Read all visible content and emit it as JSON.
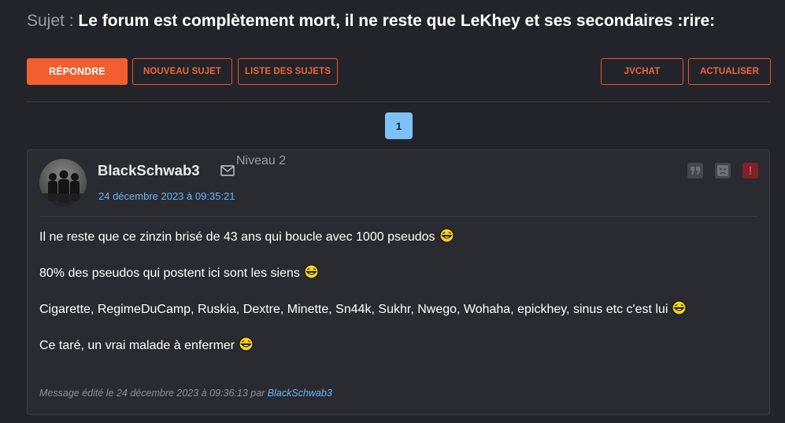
{
  "topic": {
    "label": "Sujet",
    "separator": ":",
    "title": "Le forum est complètement mort, il ne reste que LeKhey et ses secondaires :rire:"
  },
  "toolbar": {
    "reply": "RÉPONDRE",
    "new_topic": "NOUVEAU SUJET",
    "topic_list": "LISTE DES SUJETS",
    "jvchat": "JVCHAT",
    "refresh": "ACTUALISER"
  },
  "pagination": {
    "current_page": "1"
  },
  "post": {
    "author": "BlackSchwab3",
    "level": "Niveau 2",
    "date": "24 décembre 2023 à 09:35:21",
    "paragraphs": [
      "Il ne reste que ce zinzin brisé de 43 ans qui boucle avec 1000 pseudos",
      "80% des pseudos qui postent ici sont les siens",
      "Cigarette, RegimeDuCamp, Ruskia, Dextre, Minette, Sn44k, Sukhr, Nwego, Wohaha, epickhey, sinus etc c'est lui",
      "Ce taré, un vrai malade à enfermer"
    ],
    "paragraph_icons": [
      "laughing-smiley-icon",
      "laughing-smiley-icon",
      "laughing-smiley-icon",
      "laughing-smiley-icon"
    ],
    "edit_note_prefix": "Message édité le 24 décembre 2023 à 09:36:13 par",
    "edit_note_author": "BlackSchwab3",
    "icons": [
      "mail-icon",
      "quote-icon",
      "sad-face-icon",
      "alert-icon"
    ]
  },
  "colors": {
    "background": "#232429",
    "accent": "#f25e30",
    "link": "#67b7f7",
    "page_active": "#7cc2f8"
  }
}
